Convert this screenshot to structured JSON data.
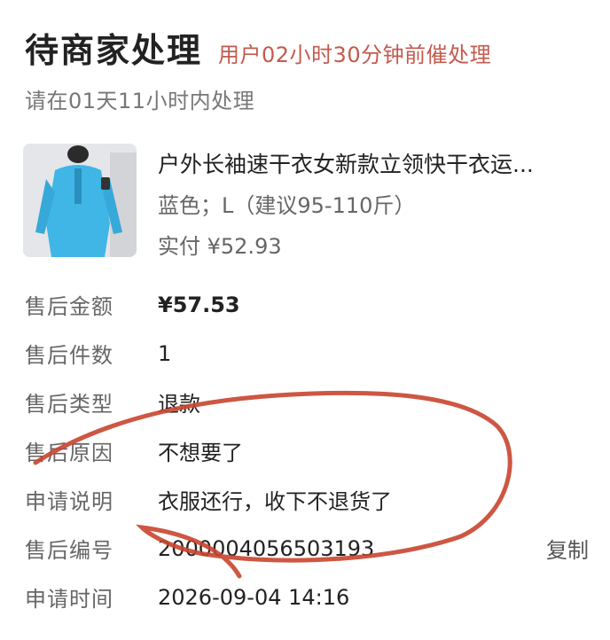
{
  "header": {
    "title": "待商家处理",
    "urge_notice": "用户02小时30分钟前催处理"
  },
  "deadline": "请在01天11小时内处理",
  "product": {
    "name": "户外长袖速干衣女新款立领快干衣运...",
    "spec": "蓝色；L（建议95-110斤）",
    "paid": "实付 ¥52.93",
    "image_icon": "product-photo-blue-jacket"
  },
  "details": [
    {
      "label": "售后金额",
      "value": "¥57.53"
    },
    {
      "label": "售后件数",
      "value": "1"
    },
    {
      "label": "售后类型",
      "value": "退款"
    },
    {
      "label": "售后原因",
      "value": "不想要了"
    },
    {
      "label": "申请说明",
      "value": "衣服还行，收下不退货了"
    },
    {
      "label": "售后编号",
      "value": "2000004056503193",
      "action": "复制"
    },
    {
      "label": "申请时间",
      "value": "2026-09-04 14:16"
    }
  ],
  "colors": {
    "urge": "#c45a4e",
    "annotation": "#c8452f"
  }
}
